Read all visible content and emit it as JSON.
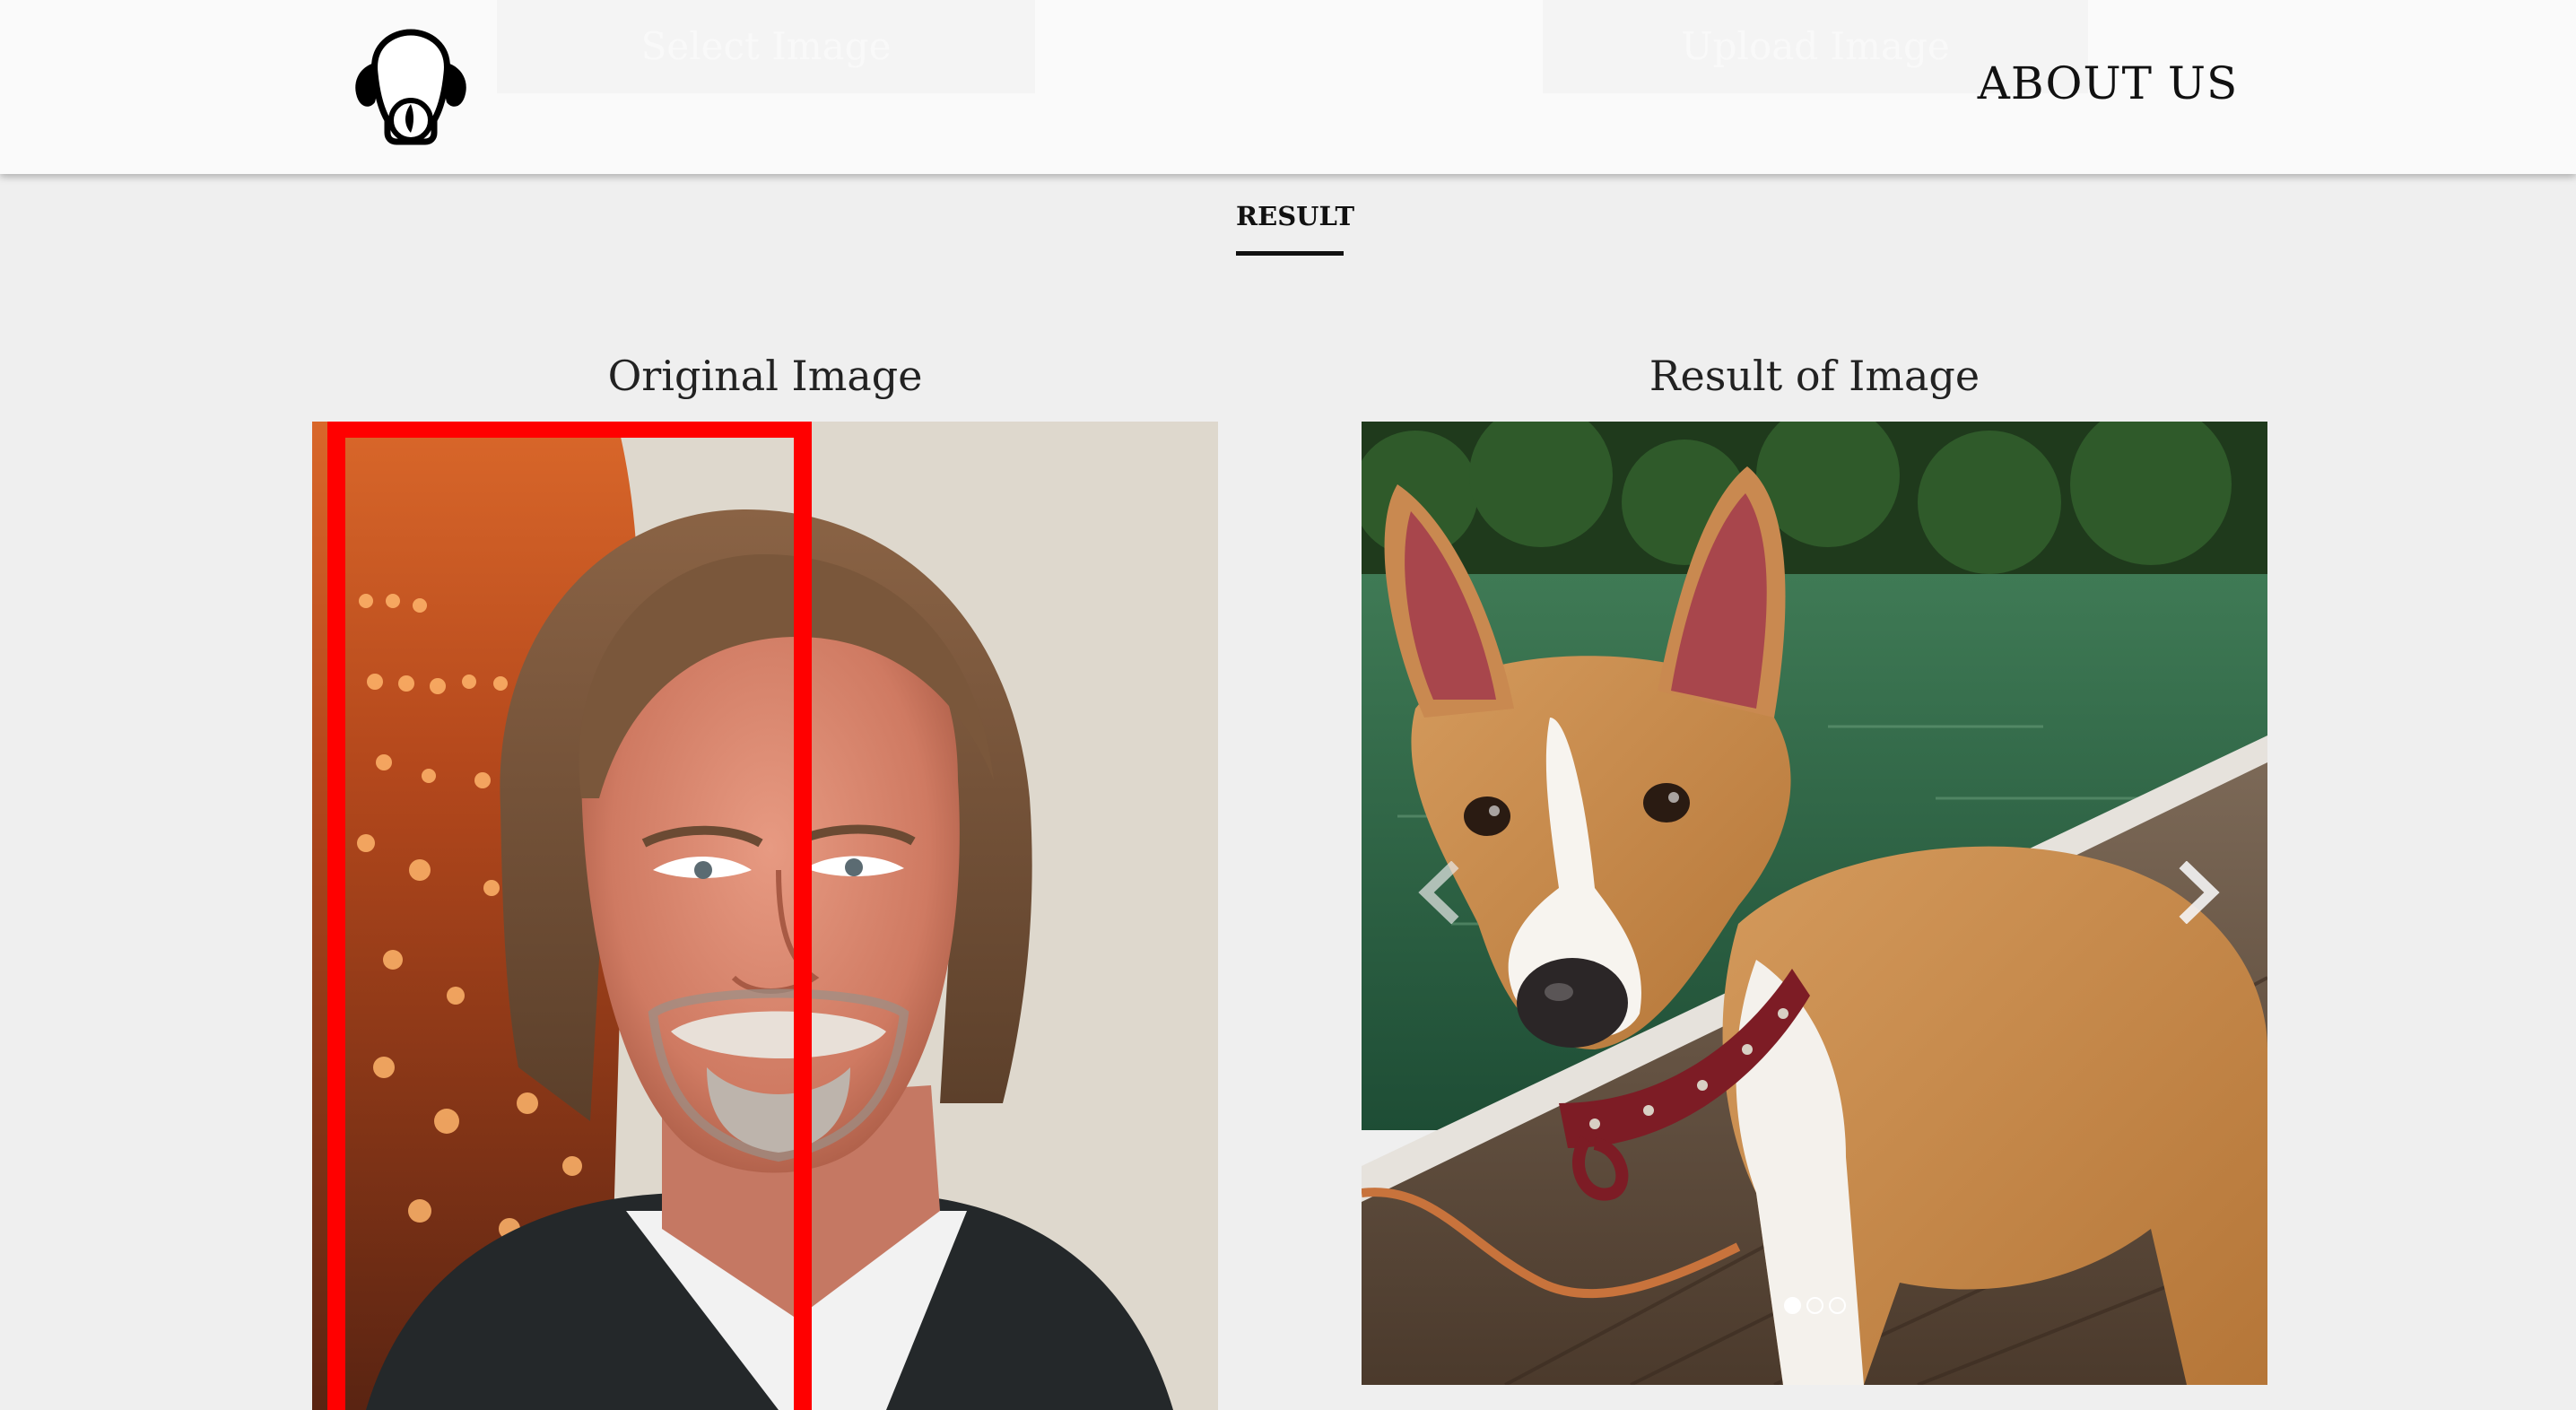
{
  "header": {
    "logo_icon": "dog-head-logo-icon",
    "select_button_label": "Select Image",
    "upload_button_label": "Upload Image",
    "about_link_label": "ABOUT US"
  },
  "tabs": {
    "result_label": "RESULT"
  },
  "original": {
    "title": "Original Image",
    "face_box_color": "#ff0000"
  },
  "result": {
    "title": "Result of Image",
    "carousel": {
      "slide_count": 3,
      "active_slide": 1,
      "prev_icon": "chevron-left-icon",
      "next_icon": "chevron-right-icon"
    }
  }
}
